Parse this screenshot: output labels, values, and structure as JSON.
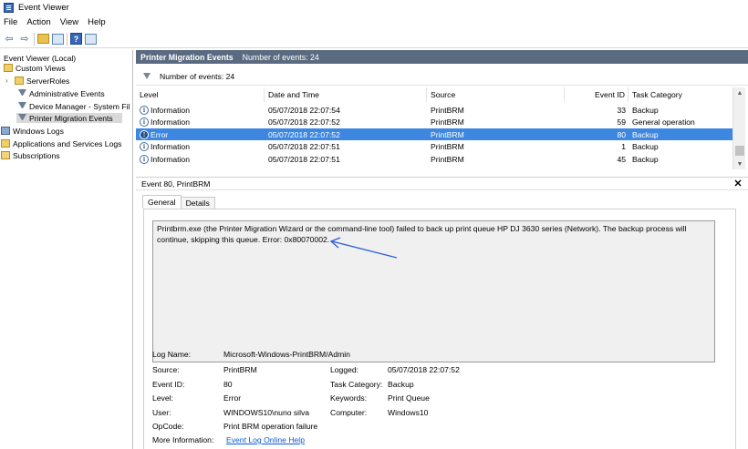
{
  "window": {
    "title": "Event Viewer"
  },
  "menu": [
    "File",
    "Action",
    "View",
    "Help"
  ],
  "tree": [
    {
      "label": "Event Viewer (Local)",
      "icon": "event-viewer-icon",
      "indent": 0
    },
    {
      "label": "Custom Views",
      "icon": "folder-icon",
      "indent": 1
    },
    {
      "label": "ServerRoles",
      "icon": "folder-icon",
      "indent": 2,
      "chevron": ">"
    },
    {
      "label": "Administrative Events",
      "icon": "filter-icon",
      "indent": 2
    },
    {
      "label": "Device Manager - System Fil",
      "icon": "filter-icon",
      "indent": 2
    },
    {
      "label": "Printer Migration Events",
      "icon": "filter-icon",
      "indent": 2,
      "selected": true
    },
    {
      "label": "Windows Logs",
      "icon": "logs-icon",
      "indent": 0
    },
    {
      "label": "Applications and Services Logs",
      "icon": "folder-icon",
      "indent": 0
    },
    {
      "label": "Subscriptions",
      "icon": "subscriptions-icon",
      "indent": 0
    }
  ],
  "pane_header": {
    "title": "Printer Migration Events",
    "count": "Number of events: 24"
  },
  "filter_bar": {
    "text": "Number of events: 24"
  },
  "table": {
    "columns": [
      "Level",
      "Date and Time",
      "Source",
      "Event ID",
      "Task Category"
    ],
    "rows": [
      {
        "level": "Information",
        "icon": "i",
        "date": "05/07/2018 22:07:54",
        "source": "PrintBRM",
        "id": "33",
        "category": "Backup"
      },
      {
        "level": "Information",
        "icon": "i",
        "date": "05/07/2018 22:07:52",
        "source": "PrintBRM",
        "id": "59",
        "category": "General operation"
      },
      {
        "level": "Error",
        "icon": "!",
        "date": "05/07/2018 22:07:52",
        "source": "PrintBRM",
        "id": "80",
        "category": "Backup",
        "selected": true
      },
      {
        "level": "Information",
        "icon": "i",
        "date": "05/07/2018 22:07:51",
        "source": "PrintBRM",
        "id": "1",
        "category": "Backup"
      },
      {
        "level": "Information",
        "icon": "i",
        "date": "05/07/2018 22:07:51",
        "source": "PrintBRM",
        "id": "45",
        "category": "Backup"
      }
    ]
  },
  "detail": {
    "header": "Event 80, PrintBRM",
    "tabs": [
      "General",
      "Details"
    ],
    "message_line1": "Printbrm.exe (the Printer Migration Wizard or the command-line tool) failed to back up print queue HP DJ 3630 series (Network). The backup process will",
    "message_line2": "continue, skipping this queue. Error: 0x80070002.",
    "fields": {
      "log_name_label": "Log Name:",
      "log_name": "Microsoft-Windows-PrintBRM/Admin",
      "source_label": "Source:",
      "source": "PrintBRM",
      "logged_label": "Logged:",
      "logged": "05/07/2018 22:07:52",
      "event_id_label": "Event ID:",
      "event_id": "80",
      "task_label": "Task Category:",
      "task": "Backup",
      "level_label": "Level:",
      "level": "Error",
      "keywords_label": "Keywords:",
      "keywords": "Print Queue",
      "user_label": "User:",
      "user": "WINDOWS10\\nuno silva",
      "computer_label": "Computer:",
      "computer": "Windows10",
      "opcode_label": "OpCode:",
      "opcode": "Print BRM operation failure",
      "more_info_label": "More Information:",
      "more_info_link": "Event Log Online Help"
    }
  }
}
